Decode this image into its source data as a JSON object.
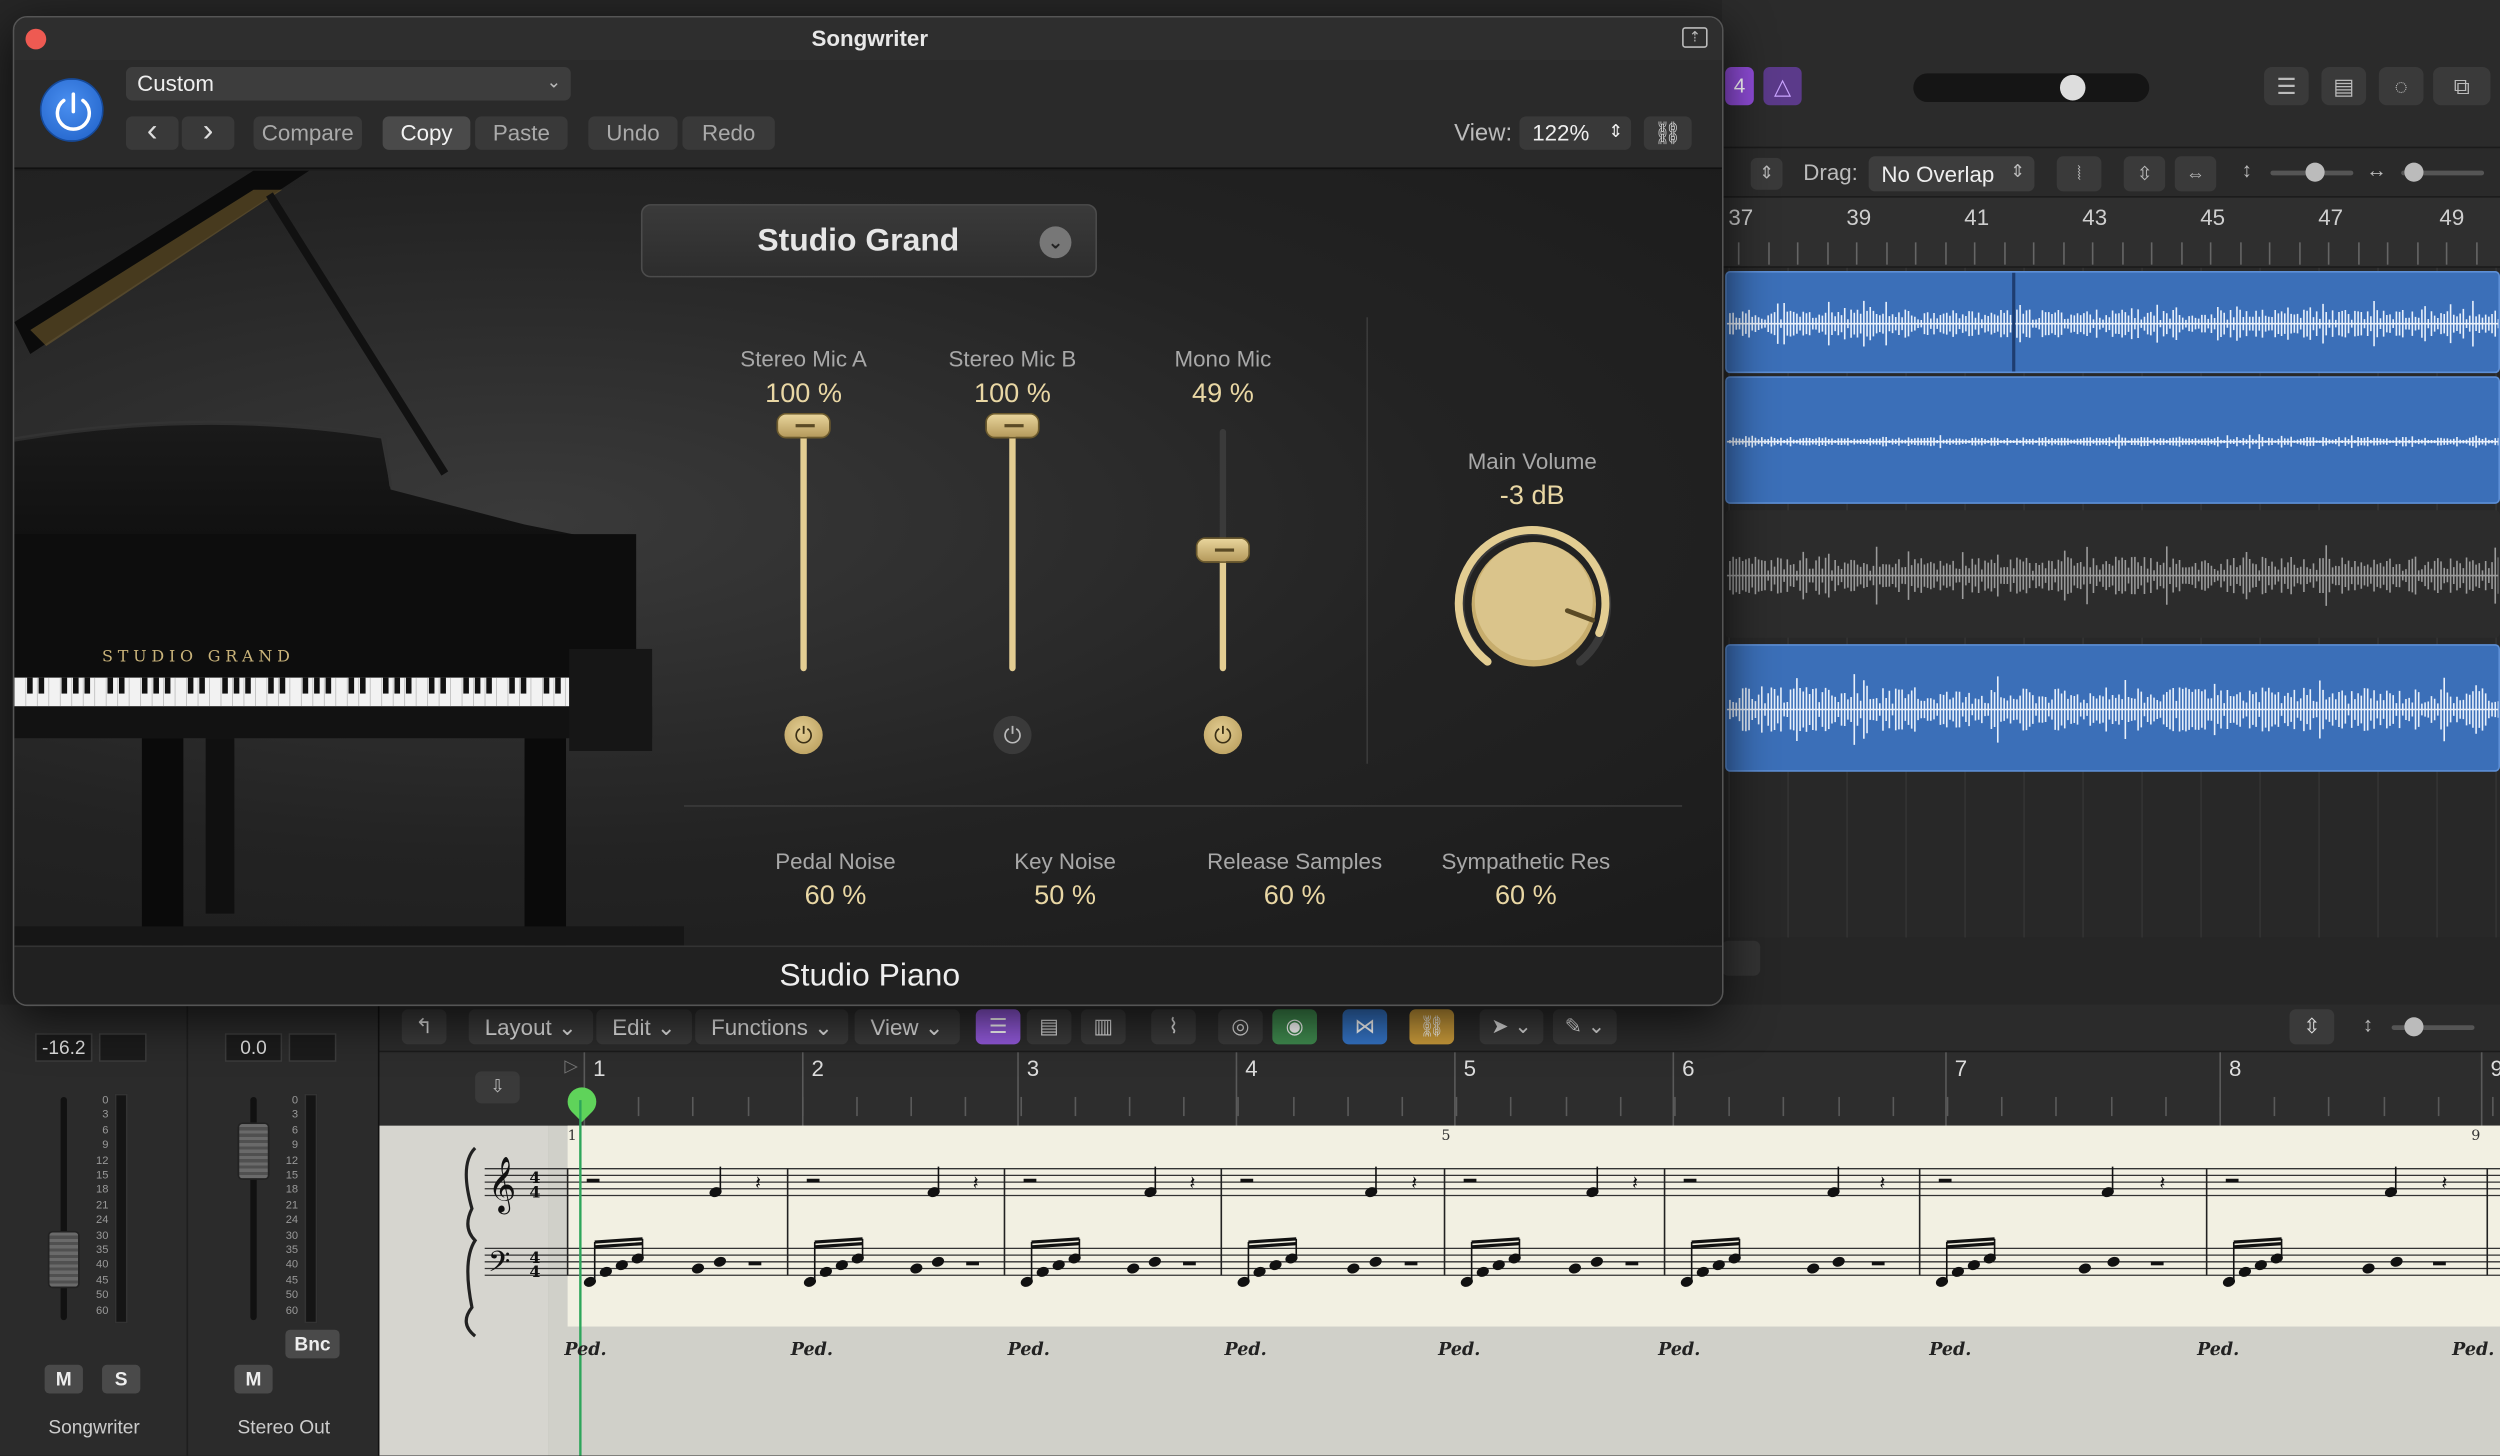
{
  "plugin": {
    "title": "Songwriter",
    "preset": "Custom",
    "buttons": {
      "prev": "‹",
      "next": "›",
      "compare": "Compare",
      "copy": "Copy",
      "paste": "Paste",
      "undo": "Undo",
      "redo": "Redo"
    },
    "view_label": "View:",
    "view_value": "122%",
    "instrument": "Studio Grand",
    "piano_brand": "STUDIO GRAND",
    "footer_title": "Studio Piano",
    "mics": [
      {
        "label": "Stereo Mic A",
        "value": "100 %",
        "level": 1.0,
        "enabled": true
      },
      {
        "label": "Stereo Mic B",
        "value": "100 %",
        "level": 1.0,
        "enabled": false
      },
      {
        "label": "Mono Mic",
        "value": "49 %",
        "level": 0.49,
        "enabled": true
      }
    ],
    "main_volume": {
      "label": "Main Volume",
      "value": "-3 dB"
    },
    "noise": [
      {
        "label": "Pedal Noise",
        "value": "60 %"
      },
      {
        "label": "Key Noise",
        "value": "50 %"
      },
      {
        "label": "Release Samples",
        "value": "60 %"
      },
      {
        "label": "Sympathetic Res",
        "value": "60 %"
      }
    ]
  },
  "daw": {
    "badge": "4",
    "drag_label": "Drag:",
    "drag_value": "No Overlap",
    "ruler": [
      "37",
      "39",
      "41",
      "43",
      "45",
      "47",
      "49"
    ]
  },
  "mixer": {
    "strips": [
      {
        "name": "Songwriter",
        "value": "-16.2",
        "mute": "M",
        "solo": "S"
      },
      {
        "name": "Stereo Out",
        "value": "0.0",
        "mute": "M",
        "bounce": "Bnc"
      }
    ],
    "scale": [
      "0",
      "3",
      "6",
      "9",
      "12",
      "15",
      "18",
      "21",
      "24",
      "30",
      "35",
      "40",
      "45",
      "50",
      "60"
    ]
  },
  "editor": {
    "menus": {
      "layout": "Layout",
      "edit": "Edit",
      "functions": "Functions",
      "view": "View"
    },
    "bars": [
      "1",
      "2",
      "3",
      "4",
      "5",
      "6",
      "7",
      "8",
      "9"
    ],
    "staff_numbers": [
      "1",
      "5",
      "9"
    ],
    "pedal_mark": "Ped."
  }
}
